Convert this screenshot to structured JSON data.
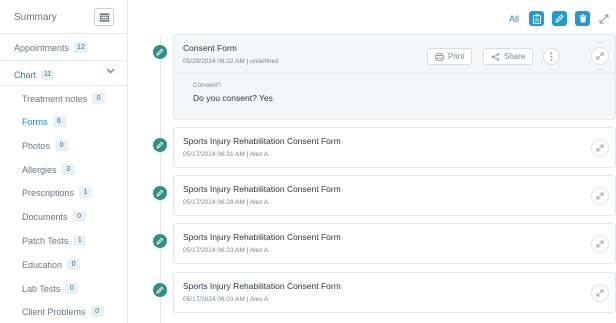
{
  "sidebar": {
    "summary_label": "Summary",
    "items": [
      {
        "label": "Appointments",
        "count": "12"
      },
      {
        "label": "Chart",
        "count": "11"
      }
    ],
    "sub_items": [
      {
        "label": "Treatment notes",
        "count": "0"
      },
      {
        "label": "Forms",
        "count": "6"
      },
      {
        "label": "Photos",
        "count": "0"
      },
      {
        "label": "Allergies",
        "count": "3"
      },
      {
        "label": "Prescriptions",
        "count": "1"
      },
      {
        "label": "Documents",
        "count": "0"
      },
      {
        "label": "Patch Tests",
        "count": "1"
      },
      {
        "label": "Education",
        "count": "0"
      },
      {
        "label": "Lab Tests",
        "count": "0"
      },
      {
        "label": "Client Problems",
        "count": "0"
      }
    ]
  },
  "toolbar": {
    "all_label": "All"
  },
  "records": [
    {
      "title": "Consent Form",
      "meta": "05/29/2024 06:32 AM | undefined",
      "print_label": "Print",
      "share_label": "Share",
      "question": "Consent?",
      "answer": "Do you consent? Yes"
    },
    {
      "title": "Sports Injury Rehabilitation Consent Form",
      "meta": "05/17/2024 06:31 AM | Alex A."
    },
    {
      "title": "Sports Injury Rehabilitation Consent Form",
      "meta": "05/17/2024 06:28 AM | Alex A."
    },
    {
      "title": "Sports Injury Rehabilitation Consent Form",
      "meta": "05/17/2024 06:23 AM | Alex A."
    },
    {
      "title": "Sports Injury Rehabilitation Consent Form",
      "meta": "05/17/2024 06:03 AM | Alex A."
    }
  ],
  "colors": {
    "accent": "#1f9bd0",
    "link": "#1f8ac0",
    "marker": "#2f8f86"
  },
  "icons": [
    "list-icon",
    "chevron-down-icon",
    "clipboard-icon",
    "pencil-icon",
    "trash-icon",
    "expand-icon",
    "print-icon",
    "share-icon",
    "more-icon"
  ]
}
